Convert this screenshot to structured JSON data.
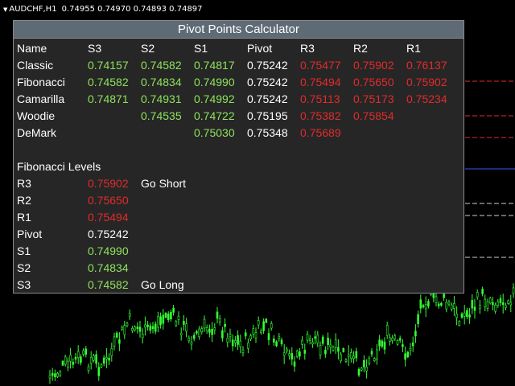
{
  "header": {
    "symbol": "AUDCHF,H1",
    "ohlc": "0.74955 0.74970 0.74893 0.74897"
  },
  "panel": {
    "title": "Pivot Points Calculator",
    "columns": [
      "Name",
      "S3",
      "S2",
      "S1",
      "Pivot",
      "R3",
      "R2",
      "R1"
    ],
    "rows": [
      {
        "name": "Classic",
        "s3": "0.74157",
        "s2": "0.74582",
        "s1": "0.74817",
        "pivot": "0.75242",
        "r3": "0.75477",
        "r2": "0.75902",
        "r1": "0.76137"
      },
      {
        "name": "Fibonacci",
        "s3": "0.74582",
        "s2": "0.74834",
        "s1": "0.74990",
        "pivot": "0.75242",
        "r3": "0.75494",
        "r2": "0.75650",
        "r1": "0.75902"
      },
      {
        "name": "Camarilla",
        "s3": "0.74871",
        "s2": "0.74931",
        "s1": "0.74992",
        "pivot": "0.75242",
        "r3": "0.75113",
        "r2": "0.75173",
        "r1": "0.75234"
      },
      {
        "name": "Woodie",
        "s3": "",
        "s2": "0.74535",
        "s1": "0.74722",
        "pivot": "0.75195",
        "r3": "0.75382",
        "r2": "0.75854",
        "r1": ""
      },
      {
        "name": "DeMark",
        "s3": "",
        "s2": "",
        "s1": "0.75030",
        "pivot": "0.75348",
        "r3": "0.75689",
        "r2": "",
        "r1": ""
      }
    ],
    "fib_heading": "Fibonacci Levels",
    "fib_levels": [
      {
        "label": "R3",
        "value": "0.75902",
        "signal": "Go Short"
      },
      {
        "label": "R2",
        "value": "0.75650",
        "signal": ""
      },
      {
        "label": "R1",
        "value": "0.75494",
        "signal": ""
      },
      {
        "label": "Pivot",
        "value": "0.75242",
        "signal": ""
      },
      {
        "label": "S1",
        "value": "0.74990",
        "signal": ""
      },
      {
        "label": "S2",
        "value": "0.74834",
        "signal": ""
      },
      {
        "label": "S3",
        "value": "0.74582",
        "signal": "Go Long"
      }
    ]
  },
  "colors": {
    "background": "#000000",
    "panel_bg": "#262626",
    "title_bar": "#5e6a75",
    "support": "#8fe35c",
    "resistance": "#e32b2b",
    "pivot": "#ffffff",
    "candle": "#33ff33"
  }
}
